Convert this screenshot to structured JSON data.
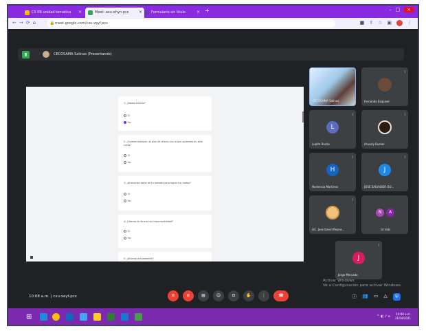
{
  "browser": {
    "tabs": [
      {
        "label": "C5 EB unidad tematica",
        "color": "#fbbc05"
      },
      {
        "label": "Meet: axu-ehyn-pcs",
        "color": "#34a853"
      },
      {
        "label": "Formulario sin titulo",
        "color": "#673ab7"
      }
    ],
    "url": "meet.google.com/cxu-xeyf-pcs"
  },
  "meet": {
    "presenter_label": "CECOSAMA Salinas (Presentando)",
    "time": "10:08 a.m.",
    "meeting_code": "cxu-xeyf-pcs"
  },
  "form": {
    "questions": [
      {
        "text": "1. ¿Sabes ahorrar?",
        "options": [
          "Sí",
          "No"
        ],
        "selected": 1
      },
      {
        "text": "2. ¿Quieres elaborar un plan de ahorro con lo que aprendes en este curso?",
        "options": [
          "Sí",
          "No"
        ],
        "selected": -1
      },
      {
        "text": "3. ¿Ahorrarías parte de tu mesada para lograr tus metas?",
        "options": [
          "Sí",
          "No"
        ],
        "selected": -1
      },
      {
        "text": "4. ¿Usarías tu dinero con responsabilidad?",
        "options": [
          "Sí",
          "No"
        ],
        "selected": -1
      },
      {
        "text": "5. ¿Ahorras actualmente?",
        "options": [],
        "selected": -1
      }
    ]
  },
  "participants": [
    {
      "name": "CECOSAMA Salinas",
      "kind": "self"
    },
    {
      "name": "Fernando Esquivel",
      "kind": "photo",
      "color": "#6b4c3b"
    },
    {
      "name": "Lupita Roche",
      "kind": "letter",
      "initial": "L",
      "color": "#5c6bc0"
    },
    {
      "name": "Aracely Ruelas",
      "kind": "photo",
      "color": "#2b1d14"
    },
    {
      "name": "Hortensia Martinez",
      "kind": "letter",
      "initial": "H",
      "color": "#1565c0"
    },
    {
      "name": "JOSE SALVADOR GO...",
      "kind": "letter",
      "initial": "J",
      "color": "#1e88e5"
    },
    {
      "name": "LIC. Jose David Reyna...",
      "kind": "photo",
      "color": "#f2c27a"
    },
    {
      "name": "14 más",
      "kind": "group",
      "initials": [
        "N",
        "A"
      ],
      "color": "#ab47bc"
    },
    {
      "name": "Jorge Mercado",
      "kind": "letter",
      "initial": "J",
      "color": "#d81b60"
    }
  ],
  "watermark": {
    "line1": "Activar Windows",
    "line2": "Ve a Configuración para activar Windows."
  },
  "taskbar": {
    "clock_time": "10:08 a.m.",
    "clock_date": "21/04/2021"
  },
  "colors": {
    "tabstrip": "#8a2be2",
    "taskbar": "#7b2ab0",
    "accent_red": "#ea4335"
  }
}
